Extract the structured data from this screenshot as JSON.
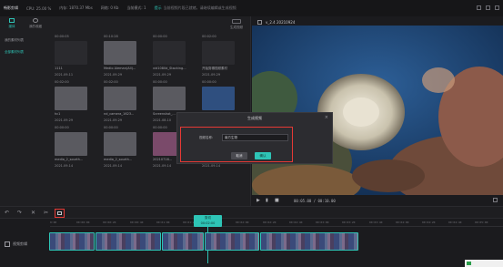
{
  "topbar": {
    "app_title": "畅影剪辑",
    "cpu": "CPU: 25.00 %",
    "memory": "内存: 1870.37 Mbs",
    "network": "网络: 0 Kb",
    "mode": "当前模式: 1",
    "notice_tag": "提示",
    "notice": "当前视频片段已就绪，请继续编辑或生成视频"
  },
  "left_tabs": {
    "media": "媒体",
    "favorites": "我的收藏"
  },
  "generate_button": "生成视频",
  "sidebar": {
    "items": [
      "我的素材列表",
      "全部素材列表"
    ]
  },
  "media_items": [
    {
      "duration": "00:00:05",
      "name": "",
      "date": "",
      "thumb": "dark"
    },
    {
      "duration": "00:10:28",
      "name": "",
      "date": "",
      "thumb": "dark"
    },
    {
      "duration": "00:00:00",
      "name": "",
      "date": "",
      "thumb": "dark"
    },
    {
      "duration": "00:02:00",
      "name": "",
      "date": "",
      "thumb": "dark"
    },
    {
      "duration": "",
      "name": "1111",
      "date": "2021.09.11",
      "thumb": "dark"
    },
    {
      "duration": "",
      "name": "Medio Aleman(All)...",
      "date": "2021.09.29",
      "thumb": "grey"
    },
    {
      "duration": "",
      "name": "vid1080d_Stacking...",
      "date": "2021.09.29",
      "thumb": "dark"
    },
    {
      "duration": "",
      "name": "开始剪辑视频素材",
      "date": "2021.09.29",
      "thumb": "dark"
    },
    {
      "duration": "00:02:00",
      "name": "",
      "date": "",
      "thumb": "dark"
    },
    {
      "duration": "00:02:00",
      "name": "",
      "date": "",
      "thumb": "dark"
    },
    {
      "duration": "00:00:00",
      "name": "",
      "date": "",
      "thumb": "dark"
    },
    {
      "duration": "00:00:00",
      "name": "",
      "date": "",
      "thumb": "dark"
    },
    {
      "duration": "",
      "name": "hc1",
      "date": "2021.09.29",
      "thumb": "grey"
    },
    {
      "duration": "",
      "name": "nd_camera_1623...",
      "date": "2021.09.29",
      "thumb": "grey"
    },
    {
      "duration": "",
      "name": "Screenshot_...",
      "date": "2021.08.10",
      "thumb": "grey"
    },
    {
      "duration": "",
      "name": "20210716...",
      "date": "2021.09.13",
      "thumb": "blue"
    },
    {
      "duration": "00:00:00",
      "name": "",
      "date": "",
      "thumb": "dark"
    },
    {
      "duration": "00:00:00",
      "name": "",
      "date": "",
      "thumb": "dark"
    },
    {
      "duration": "00:00:00",
      "name": "",
      "date": "",
      "thumb": "dark"
    },
    {
      "duration": "00:00:00",
      "name": "",
      "date": "",
      "thumb": "dark"
    },
    {
      "duration": "",
      "name": "media_2_sourth...",
      "date": "2021.09.14",
      "thumb": "grey"
    },
    {
      "duration": "",
      "name": "media_2_sourth...",
      "date": "2021.09.14",
      "thumb": "grey"
    },
    {
      "duration": "",
      "name": "20210716...",
      "date": "2021.09.14",
      "thumb": "pink"
    },
    {
      "duration": "",
      "name": "",
      "date": "2021.09.14",
      "thumb": "none"
    }
  ],
  "preview": {
    "title": "v_2.4 20210924",
    "time_display": "00:05.00 / 00:10.00"
  },
  "dialog": {
    "title": "生成视频",
    "field_label": "视频名称:",
    "field_value": "南方生物",
    "cancel": "取消",
    "ok": "确认"
  },
  "timeline": {
    "ruler_ticks": [
      "0:00",
      "00:00:00",
      "00:00:20",
      "00:00:40",
      "00:01:00",
      "00:01:20",
      "00:01:40",
      "00:02:00",
      "00:02:20",
      "00:02:40",
      "00:03:00",
      "00:03:20",
      "00:03:40",
      "00:04:00",
      "00:04:20",
      "00:04:40",
      "00:05:00"
    ],
    "playhead_label": "剪切",
    "playhead_time": "00:02:00",
    "track_label": "视频剪辑"
  },
  "colors": {
    "accent": "#2ec4b6",
    "highlight_red": "#e53935",
    "panel_bg": "#1f1f22"
  }
}
